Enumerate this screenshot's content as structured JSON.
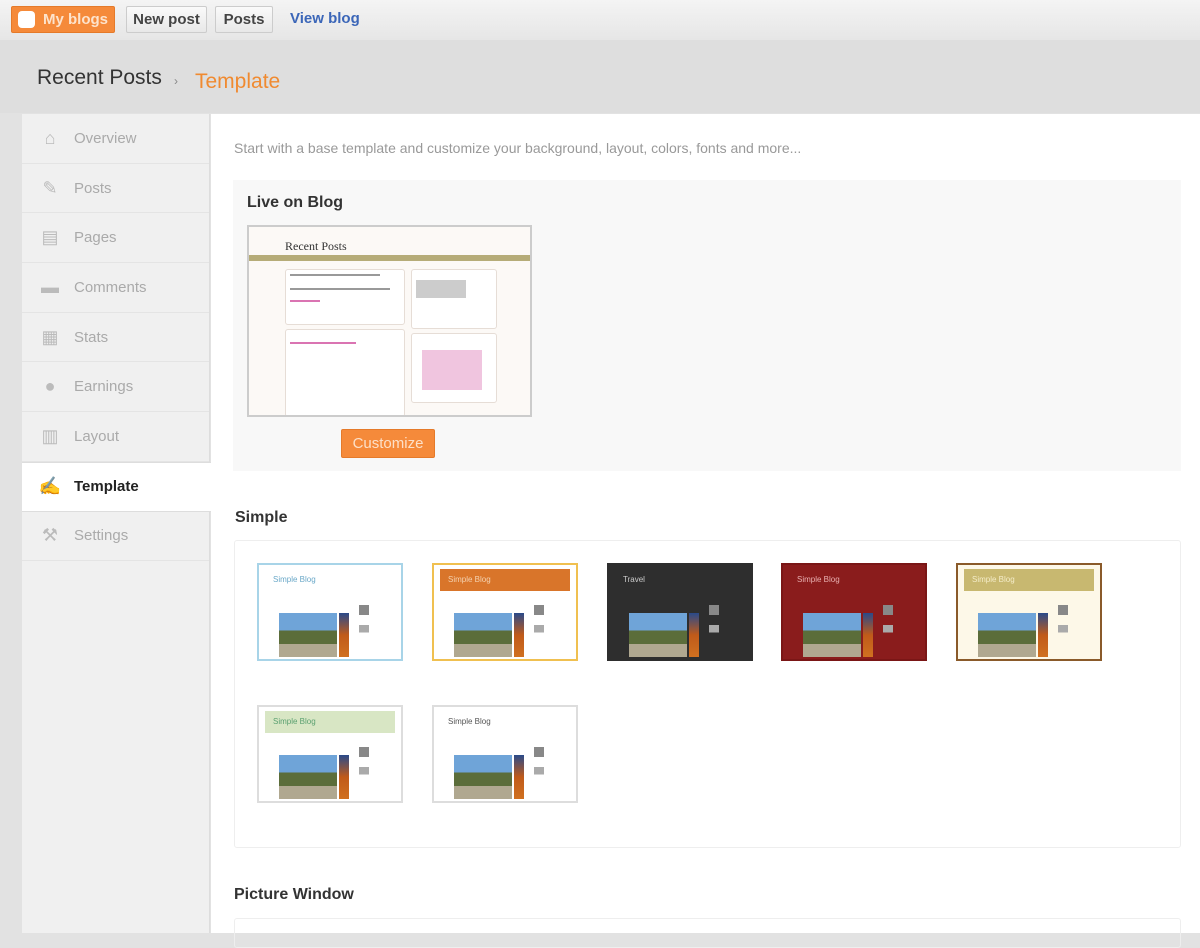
{
  "topbar": {
    "my_blogs": "My blogs",
    "new_post": "New post",
    "posts": "Posts",
    "view_blog": "View blog"
  },
  "breadcrumb": {
    "blog": "Recent Posts",
    "separator": "›",
    "current": "Template"
  },
  "sidebar": {
    "items": [
      {
        "label": "Overview",
        "icon": "home-icon"
      },
      {
        "label": "Posts",
        "icon": "pencil-icon"
      },
      {
        "label": "Pages",
        "icon": "pages-icon"
      },
      {
        "label": "Comments",
        "icon": "comment-icon"
      },
      {
        "label": "Stats",
        "icon": "stats-icon"
      },
      {
        "label": "Earnings",
        "icon": "earnings-icon"
      },
      {
        "label": "Layout",
        "icon": "layout-icon"
      },
      {
        "label": "Template",
        "icon": "paintbrush-icon",
        "active": true
      },
      {
        "label": "Settings",
        "icon": "wrench-icon"
      }
    ]
  },
  "main": {
    "intro": "Start with a base template and customize your background, layout, colors, fonts and more...",
    "live": {
      "heading": "Live on Blog",
      "preview_title": "Recent Posts",
      "customize": "Customize"
    },
    "simple": {
      "heading": "Simple",
      "templates": [
        {
          "title": "Simple Blog",
          "bg": "#ffffff",
          "head": "#ffffff",
          "text": "#6aa8c8",
          "border": "#a8d4e8"
        },
        {
          "title": "Simple Blog",
          "bg": "#ffffff",
          "head": "#d9752a",
          "text": "#f4d2b0",
          "border": "#f0c050"
        },
        {
          "title": "Travel",
          "bg": "#2e2e2e",
          "head": "#2e2e2e",
          "text": "#cccccc",
          "border": "#2e2e2e"
        },
        {
          "title": "Simple Blog",
          "bg": "#8a1c1c",
          "head": "#8a1c1c",
          "text": "#e8b0b0",
          "border": "#7a1616"
        },
        {
          "title": "Simple Blog",
          "bg": "#fdf8e8",
          "head": "#c8b870",
          "text": "#f4ecc8",
          "border": "#8a5a2a"
        },
        {
          "title": "Simple Blog",
          "bg": "#ffffff",
          "head": "#d8e6c4",
          "text": "#5aa070",
          "border": "#ddd"
        },
        {
          "title": "Simple Blog",
          "bg": "#ffffff",
          "head": "#ffffff",
          "text": "#555555",
          "border": "#ddd"
        }
      ]
    },
    "picture_window": {
      "heading": "Picture Window"
    }
  },
  "colors": {
    "accent": "#f58a3a",
    "link": "#3b66b8"
  }
}
